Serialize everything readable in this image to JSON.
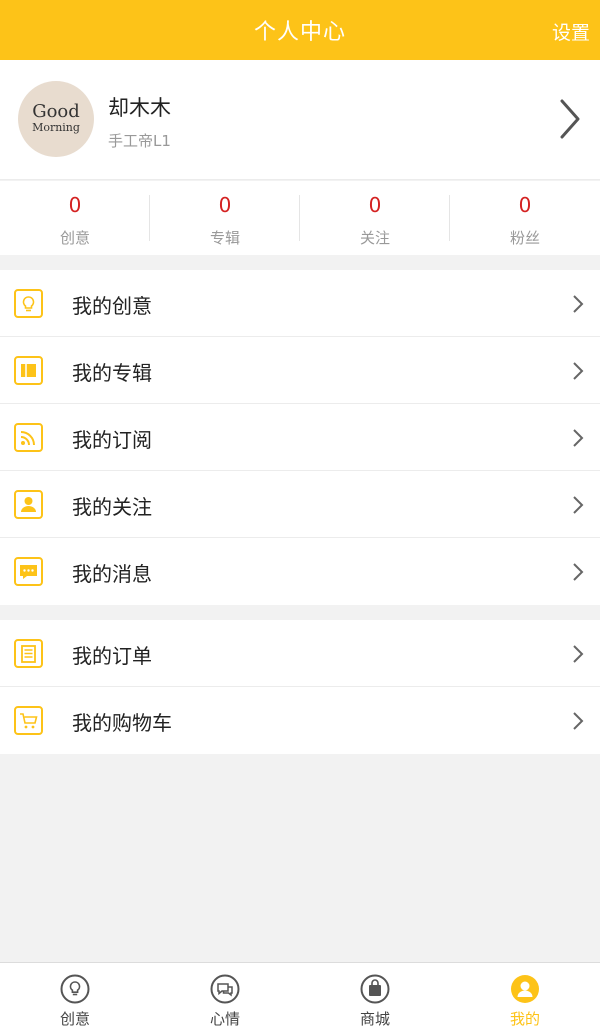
{
  "header": {
    "title": "个人中心",
    "settings_label": "设置"
  },
  "profile": {
    "name": "却木木",
    "level": "手工帝L1",
    "avatar_text_line1": "Good",
    "avatar_text_line2": "Morning"
  },
  "stats": [
    {
      "value": "0",
      "label": "创意"
    },
    {
      "value": "0",
      "label": "专辑"
    },
    {
      "value": "0",
      "label": "关注"
    },
    {
      "value": "0",
      "label": "粉丝"
    }
  ],
  "menu_group1": [
    {
      "label": "我的创意",
      "icon": "bulb-icon"
    },
    {
      "label": "我的专辑",
      "icon": "album-icon"
    },
    {
      "label": "我的订阅",
      "icon": "rss-icon"
    },
    {
      "label": "我的关注",
      "icon": "person-icon"
    },
    {
      "label": "我的消息",
      "icon": "message-icon"
    }
  ],
  "menu_group2": [
    {
      "label": "我的订单",
      "icon": "order-icon"
    },
    {
      "label": "我的购物车",
      "icon": "cart-icon"
    }
  ],
  "tabbar": [
    {
      "label": "创意",
      "icon": "bulb-icon",
      "active": false
    },
    {
      "label": "心情",
      "icon": "chat-icon",
      "active": false
    },
    {
      "label": "商城",
      "icon": "shop-bag-icon",
      "active": false
    },
    {
      "label": "我的",
      "icon": "user-icon",
      "active": true
    }
  ],
  "colors": {
    "accent": "#fdc318",
    "stat_number": "#d42121"
  }
}
